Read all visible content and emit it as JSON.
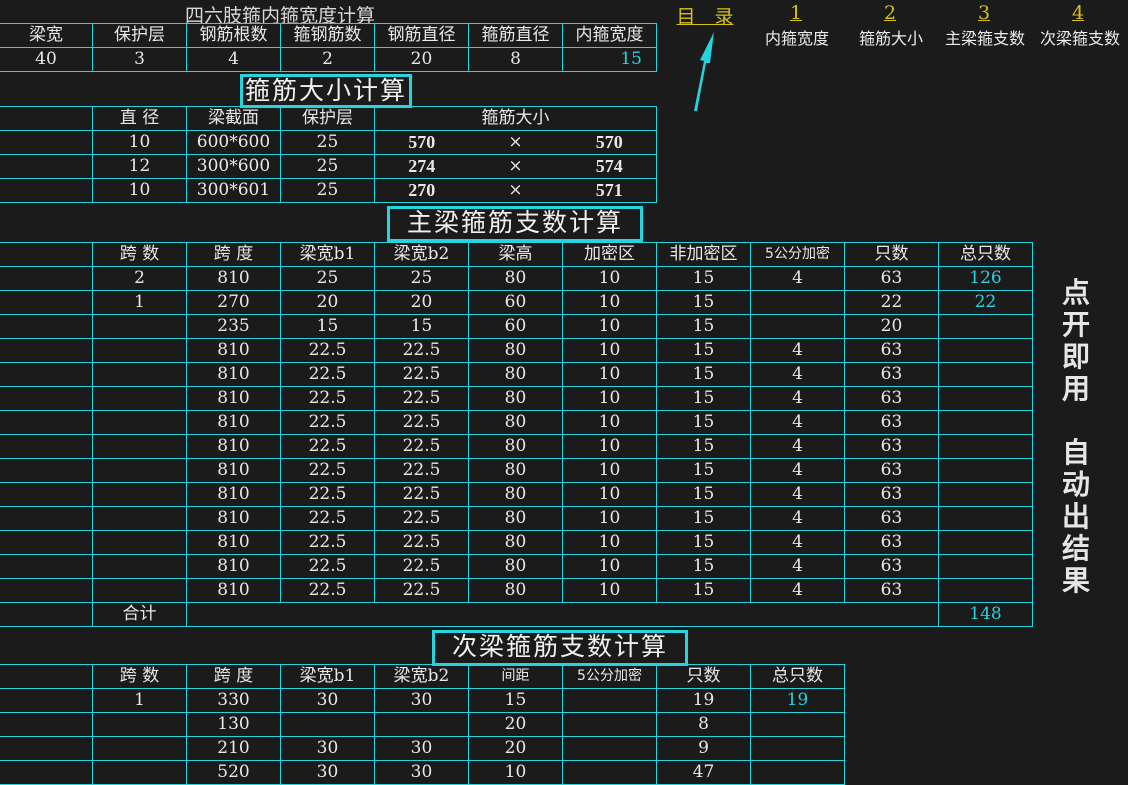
{
  "inner_width": {
    "title": "四六肢箍内箍宽度计算",
    "headers": [
      "梁宽",
      "保护层",
      "钢筋根数",
      "箍钢筋数",
      "钢筋直径",
      "箍筋直径",
      "内箍宽度"
    ],
    "values": [
      "40",
      "3",
      "4",
      "2",
      "20",
      "8",
      "15"
    ]
  },
  "nav": {
    "index_label": "目　录",
    "items": [
      {
        "num": "1",
        "label": "内箍宽度"
      },
      {
        "num": "2",
        "label": "箍筋大小"
      },
      {
        "num": "3",
        "label": "主梁箍支数"
      },
      {
        "num": "4",
        "label": "次梁箍支数"
      }
    ],
    "arrow_color": "#27d3dc"
  },
  "stirrup_size": {
    "title": "箍筋大小计算",
    "headers": [
      "直 径",
      "梁截面",
      "保护层",
      "箍筋大小"
    ],
    "rows": [
      {
        "diameter": "10",
        "section": "600*600",
        "cover": "25",
        "a": "570",
        "x": "×",
        "b": "570"
      },
      {
        "diameter": "12",
        "section": "300*600",
        "cover": "25",
        "a": "274",
        "x": "×",
        "b": "574"
      },
      {
        "diameter": "10",
        "section": "300*601",
        "cover": "25",
        "a": "270",
        "x": "×",
        "b": "571"
      }
    ]
  },
  "main_beam": {
    "title": "主梁箍筋支数计算",
    "headers": [
      "跨 数",
      "跨 度",
      "梁宽b1",
      "梁宽b2",
      "梁高",
      "加密区",
      "非加密区",
      "5公分加密",
      "只数",
      "总只数"
    ],
    "rows": [
      [
        "2",
        "810",
        "25",
        "25",
        "80",
        "10",
        "15",
        "4",
        "63",
        "126"
      ],
      [
        "1",
        "270",
        "20",
        "20",
        "60",
        "10",
        "15",
        "",
        "22",
        "22"
      ],
      [
        "",
        "235",
        "15",
        "15",
        "60",
        "10",
        "15",
        "",
        "20",
        ""
      ],
      [
        "",
        "810",
        "22.5",
        "22.5",
        "80",
        "10",
        "15",
        "4",
        "63",
        ""
      ],
      [
        "",
        "810",
        "22.5",
        "22.5",
        "80",
        "10",
        "15",
        "4",
        "63",
        ""
      ],
      [
        "",
        "810",
        "22.5",
        "22.5",
        "80",
        "10",
        "15",
        "4",
        "63",
        ""
      ],
      [
        "",
        "810",
        "22.5",
        "22.5",
        "80",
        "10",
        "15",
        "4",
        "63",
        ""
      ],
      [
        "",
        "810",
        "22.5",
        "22.5",
        "80",
        "10",
        "15",
        "4",
        "63",
        ""
      ],
      [
        "",
        "810",
        "22.5",
        "22.5",
        "80",
        "10",
        "15",
        "4",
        "63",
        ""
      ],
      [
        "",
        "810",
        "22.5",
        "22.5",
        "80",
        "10",
        "15",
        "4",
        "63",
        ""
      ],
      [
        "",
        "810",
        "22.5",
        "22.5",
        "80",
        "10",
        "15",
        "4",
        "63",
        ""
      ],
      [
        "",
        "810",
        "22.5",
        "22.5",
        "80",
        "10",
        "15",
        "4",
        "63",
        ""
      ],
      [
        "",
        "810",
        "22.5",
        "22.5",
        "80",
        "10",
        "15",
        "4",
        "63",
        ""
      ],
      [
        "",
        "810",
        "22.5",
        "22.5",
        "80",
        "10",
        "15",
        "4",
        "63",
        ""
      ]
    ],
    "total_label": "合计",
    "total_value": "148"
  },
  "secondary_beam": {
    "title": "次梁箍筋支数计算",
    "headers": [
      "跨 数",
      "跨 度",
      "梁宽b1",
      "梁宽b2",
      "间距",
      "5公分加密",
      "只数",
      "总只数"
    ],
    "rows": [
      [
        "1",
        "330",
        "30",
        "30",
        "15",
        "",
        "19",
        "19"
      ],
      [
        "",
        "130",
        "",
        "",
        "20",
        "",
        "8",
        ""
      ],
      [
        "",
        "210",
        "30",
        "30",
        "20",
        "",
        "9",
        ""
      ],
      [
        "",
        "520",
        "30",
        "30",
        "10",
        "",
        "47",
        ""
      ]
    ]
  },
  "side_note": {
    "line1": "点开即用",
    "line2": "自动出结果"
  },
  "colors": {
    "background": "#1b1b1b",
    "grid": "#27d3dc",
    "highlight_value": "#27d3dc",
    "nav_link": "#d4c21a"
  }
}
